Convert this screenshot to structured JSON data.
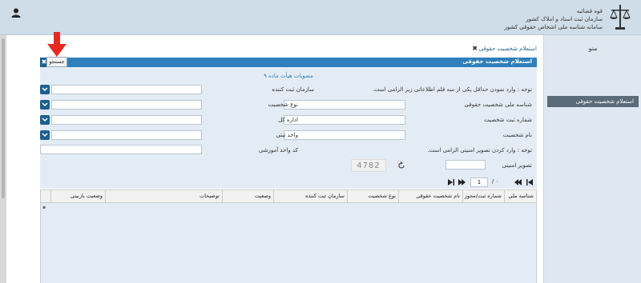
{
  "header": {
    "org_line1": "قوه قضائیه",
    "org_line2": "سازمان ثبت اسناد و املاک کشور",
    "org_line3": "سامانه شناسه ملی اشخاص حقوقی کشور",
    "user_icon": "user-icon",
    "emblem_icon": "emblem-icon"
  },
  "sidebar": {
    "title": "منو",
    "items": [
      {
        "label": "استعلام شخصیت حقوقی",
        "active": true
      }
    ]
  },
  "tabs": {
    "inquiry_tab": "استعلام شخصیت حقوقی",
    "search_tab": "جستجو"
  },
  "panel": {
    "title": "استعلام شخصیت حقوقی",
    "subtitle": "مصوبات هیأت ماده ۹",
    "note1": "توجه : وارد نمودن حداقل یکی از سه قلم اطلاعاتی زیر الزامی است.",
    "note2": "توجه : وارد کردن تصویر امنیتی الزامی است.",
    "fields": {
      "national_id": {
        "label": "شناسه ملی شخصیت حقوقی",
        "value": ""
      },
      "reg_number": {
        "label": "شماره ثبت شخصیت",
        "value": ""
      },
      "entity_name": {
        "label": "نام شخصیت",
        "value": ""
      },
      "security_image": {
        "label": "تصویر امنیتی",
        "value": ""
      },
      "reg_org": {
        "label": "سازمان ثبت کننده",
        "value": ""
      },
      "entity_type": {
        "label": "نوع شخصیت",
        "value": ""
      },
      "general_office": {
        "label": "اداره کل",
        "value": ""
      },
      "reg_unit": {
        "label": "واحد ثبتی",
        "value": ""
      },
      "training_unit": {
        "label": "کد واحد آموزشی",
        "value": ""
      }
    },
    "captcha_text": "4782"
  },
  "pager": {
    "page": "1",
    "of_text": "/ ۰"
  },
  "grid": {
    "columns": [
      "شناسه ملی",
      "شماره ثبت/مجوز",
      "نام شخصیت حقوقی",
      "نوع شخصیت",
      "سازمان ثبت کننده",
      "وضعیت",
      "توضیحات",
      "وضعیت بازبینی"
    ]
  },
  "colors": {
    "accent": "#2f7fbc",
    "header_bg": "#cfdde8",
    "form_bg": "#e3ecf5",
    "arrow": "#e52b20"
  }
}
